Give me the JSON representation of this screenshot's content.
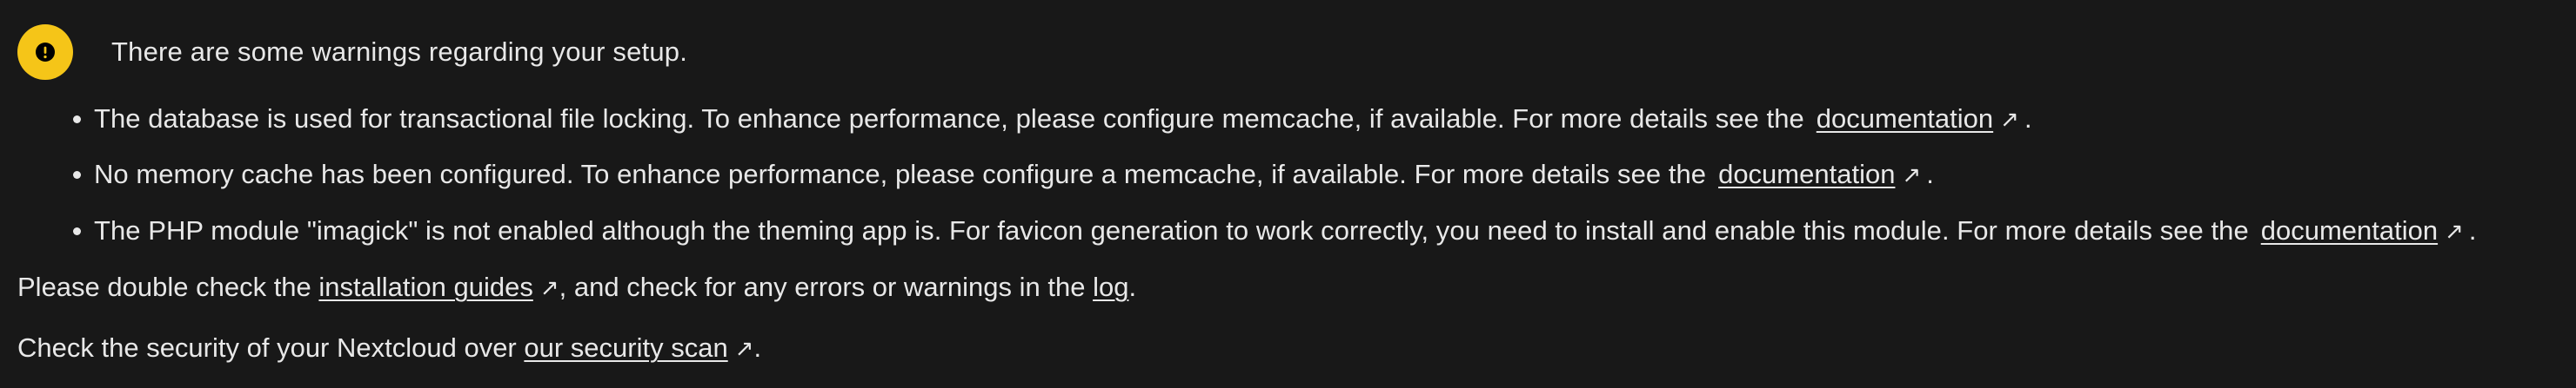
{
  "header": {
    "icon": "exclamation-warning-icon",
    "accent_color": "#f5c518",
    "title": "There are some warnings regarding your setup."
  },
  "warnings": [
    {
      "text": "The database is used for transactional file locking. To enhance performance, please configure memcache, if available. For more details see the",
      "link_label": "documentation",
      "link_icon": "external-link-arrow-icon",
      "suffix": "."
    },
    {
      "text": "No memory cache has been configured. To enhance performance, please configure a memcache, if available. For more details see the",
      "link_label": "documentation",
      "link_icon": "external-link-arrow-icon",
      "suffix": "."
    },
    {
      "text": "The PHP module \"imagick\" is not enabled although the theming app is. For favicon generation to work correctly, you need to install and enable this module. For more details see the",
      "link_label": "documentation",
      "link_icon": "external-link-arrow-icon",
      "suffix": "."
    }
  ],
  "footer": {
    "line1": {
      "before": "Please double check the ",
      "guides_link": "installation guides",
      "guides_icon": "external-link-arrow-icon",
      "middle": ", and check for any errors or warnings in the ",
      "log_link": "log",
      "after": "."
    },
    "line2": {
      "before": "Check the security of your Nextcloud over ",
      "scan_link": "our security scan",
      "scan_icon": "external-link-arrow-icon",
      "after": "."
    }
  },
  "colors": {
    "background": "#181818",
    "text": "#e8e8e8",
    "warning": "#f5c518"
  }
}
